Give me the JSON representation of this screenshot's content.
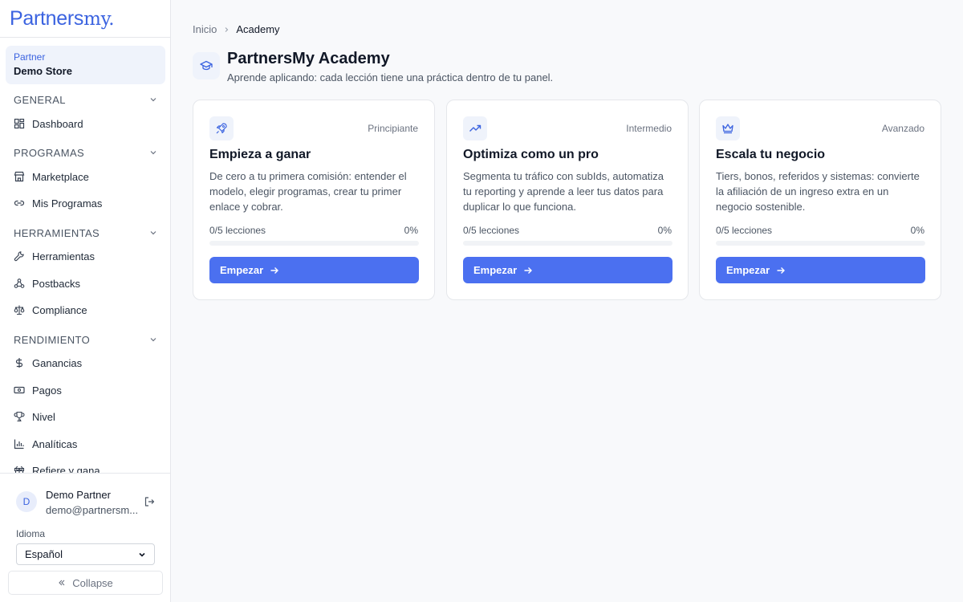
{
  "brand": {
    "logo_bold": "Partners",
    "logo_serif": "my",
    "logo_dot": ".",
    "color": "#3b63e0"
  },
  "sidebar": {
    "partner_label": "Partner",
    "partner_name": "Demo Store",
    "sections": [
      {
        "title": "GENERAL",
        "items": [
          {
            "label": "Dashboard",
            "icon": "dashboard-icon"
          }
        ]
      },
      {
        "title": "PROGRAMAS",
        "items": [
          {
            "label": "Marketplace",
            "icon": "store-icon"
          },
          {
            "label": "Mis Programas",
            "icon": "link-icon"
          }
        ]
      },
      {
        "title": "HERRAMIENTAS",
        "items": [
          {
            "label": "Herramientas",
            "icon": "wrench-icon"
          },
          {
            "label": "Postbacks",
            "icon": "webhook-icon"
          },
          {
            "label": "Compliance",
            "icon": "scale-icon"
          }
        ]
      },
      {
        "title": "RENDIMIENTO",
        "items": [
          {
            "label": "Ganancias",
            "icon": "dollar-icon"
          },
          {
            "label": "Pagos",
            "icon": "banknote-icon"
          },
          {
            "label": "Nivel",
            "icon": "trophy-icon"
          },
          {
            "label": "Analíticas",
            "icon": "bar-chart-icon"
          },
          {
            "label": "Refiere y gana",
            "icon": "gift-icon"
          }
        ]
      }
    ],
    "user": {
      "initial": "D",
      "name": "Demo Partner",
      "email": "demo@partnersm..."
    },
    "language_label": "Idioma",
    "language_value": "Español",
    "collapse_label": "Collapse"
  },
  "breadcrumb": {
    "home": "Inicio",
    "current": "Academy"
  },
  "header": {
    "title": "PartnersMy Academy",
    "subtitle": "Aprende aplicando: cada lección tiene una práctica dentro de tu panel.",
    "icon": "graduation-cap-icon"
  },
  "cards": [
    {
      "icon": "rocket-icon",
      "level": "Principiante",
      "title": "Empieza a ganar",
      "description": "De cero a tu primera comisión: entender el modelo, elegir programas, crear tu primer enlace y cobrar.",
      "progress_label": "0/5 lecciones",
      "progress_percent": "0%",
      "progress": 0,
      "button": "Empezar"
    },
    {
      "icon": "trending-up-icon",
      "level": "Intermedio",
      "title": "Optimiza como un pro",
      "description": "Segmenta tu tráfico con subIds, automatiza tu reporting y aprende a leer tus datos para duplicar lo que funciona.",
      "progress_label": "0/5 lecciones",
      "progress_percent": "0%",
      "progress": 0,
      "button": "Empezar"
    },
    {
      "icon": "crown-icon",
      "level": "Avanzado",
      "title": "Escala tu negocio",
      "description": "Tiers, bonos, referidos y sistemas: convierte la afiliación de un ingreso extra en un negocio sostenible.",
      "progress_label": "0/5 lecciones",
      "progress_percent": "0%",
      "progress": 0,
      "button": "Empezar"
    }
  ],
  "colors": {
    "accent": "#3b63e0",
    "button": "#4b70f0",
    "badge_bg": "#eff3fb"
  }
}
